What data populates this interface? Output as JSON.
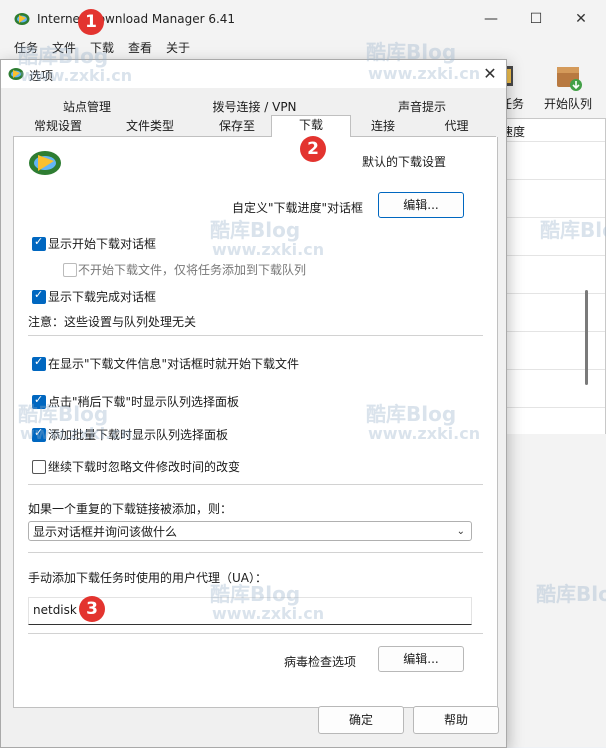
{
  "main_window": {
    "title": "Internet Download Manager 6.41",
    "menu": [
      "任务",
      "文件",
      "下载",
      "查看",
      "关于"
    ],
    "toolbar_labels": [
      "任务",
      "开始队列"
    ],
    "list_header": "速度"
  },
  "dialog": {
    "title": "选项",
    "tabs_row1": [
      "站点管理",
      "拨号连接 / VPN",
      "声音提示"
    ],
    "tabs_row2": [
      "常规设置",
      "文件类型",
      "保存至",
      "下载",
      "连接",
      "代理"
    ],
    "active_tab": "下载",
    "section_heading": "默认的下载设置",
    "progress_dialog_label": "自定义\"下载进度\"对话框",
    "edit_label": "编辑...",
    "options": [
      {
        "label": "显示开始下载对话框",
        "checked": true,
        "enabled": true
      },
      {
        "label": "不开始下载文件，仅将任务添加到下载队列",
        "checked": false,
        "enabled": false
      },
      {
        "label": "显示下载完成对话框",
        "checked": true,
        "enabled": true
      }
    ],
    "note": "注意：这些设置与队列处理无关",
    "options2": [
      {
        "label": "在显示\"下载文件信息\"对话框时就开始下载文件",
        "checked": true
      },
      {
        "label": "点击\"稍后下载\"时显示队列选择面板",
        "checked": true
      },
      {
        "label": "添加批量下载时显示队列选择面板",
        "checked": true
      },
      {
        "label": "继续下载时忽略文件修改时间的改变",
        "checked": false
      }
    ],
    "duplicate_label": "如果一个重复的下载链接被添加，则：",
    "duplicate_value": "显示对话框并询问该做什么",
    "ua_label": "手动添加下载任务时使用的用户代理（UA）：",
    "ua_value": "netdisk",
    "virus_label": "病毒检查选项",
    "virus_edit_label": "编辑...",
    "ok_label": "确定",
    "help_label": "帮助"
  },
  "badges": [
    "1",
    "2",
    "3"
  ],
  "watermark": {
    "brand": "酷库Blog",
    "url": "www.zxki.cn"
  },
  "colors": {
    "accent": "#0067c0",
    "badge": "#e3342f"
  }
}
